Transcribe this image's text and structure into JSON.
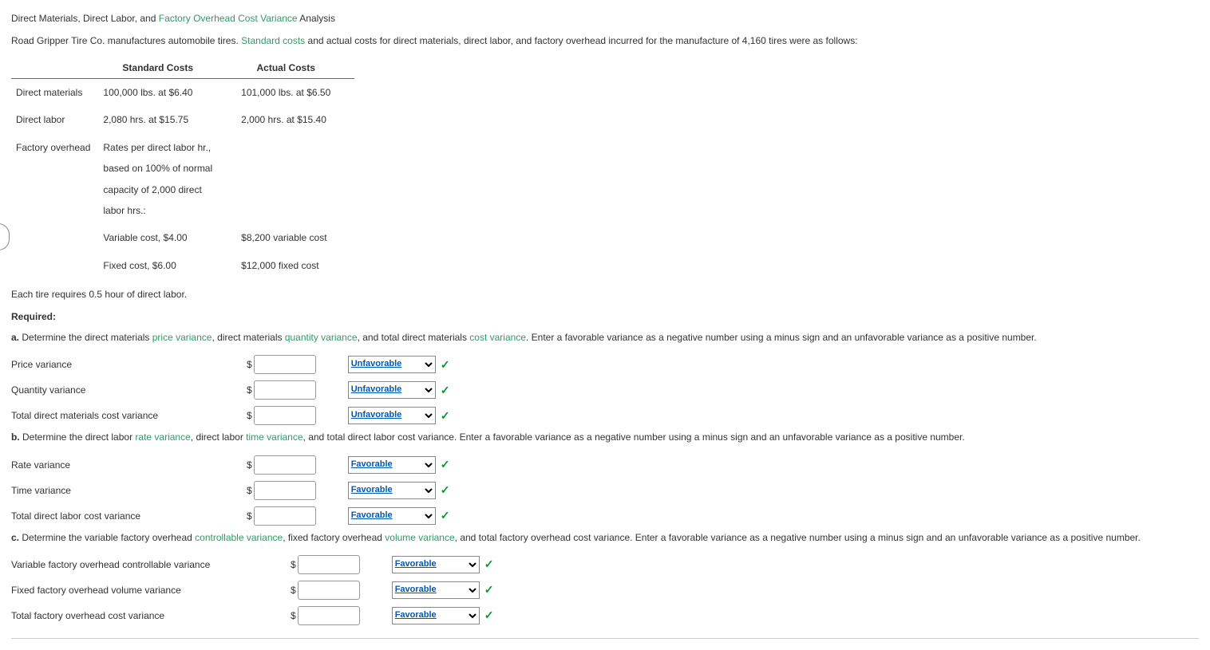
{
  "title": {
    "pre": "Direct Materials, Direct Labor, and ",
    "link": "Factory Overhead Cost Variance",
    "post": " Analysis"
  },
  "intro": {
    "pre": "Road Gripper Tire Co. manufactures automobile tires. ",
    "link": "Standard costs",
    "post": " and actual costs for direct materials, direct labor, and factory overhead incurred for the manufacture of 4,160 tires were as follows:"
  },
  "cost_table": {
    "headers": {
      "c1": "",
      "c2": "Standard Costs",
      "c3": "Actual Costs"
    },
    "rows": [
      {
        "label": "Direct materials",
        "std": "100,000 lbs. at $6.40",
        "act": "101,000 lbs. at $6.50"
      },
      {
        "label": "Direct labor",
        "std": "2,080 hrs. at $15.75",
        "act": "2,000 hrs. at $15.40"
      },
      {
        "label": "Factory overhead",
        "std": "Rates per direct labor hr.,\nbased on 100% of normal\ncapacity of 2,000 direct\nlabor hrs.:",
        "act": ""
      },
      {
        "label": "",
        "std": "   Variable cost, $4.00",
        "act": "$8,200 variable cost"
      },
      {
        "label": "",
        "std": "   Fixed cost, $6.00",
        "act": "$12,000 fixed cost"
      }
    ]
  },
  "note": "Each tire requires 0.5 hour of direct labor.",
  "required_heading": "Required:",
  "questions": {
    "a": {
      "letter": "a.",
      "text1": "  Determine the direct materials ",
      "link1": "price variance",
      "text2": ", direct materials ",
      "link2": "quantity variance",
      "text3": ", and total direct materials ",
      "link3": "cost variance",
      "text4": ". Enter a favorable variance as a negative number using a minus sign and an unfavorable variance as a positive number.",
      "rows": [
        {
          "label": "Price variance",
          "dd": "Unfavorable"
        },
        {
          "label": "Quantity variance",
          "dd": "Unfavorable"
        },
        {
          "label": "Total direct materials cost variance",
          "dd": "Unfavorable"
        }
      ]
    },
    "b": {
      "letter": "b.",
      "text1": "  Determine the direct labor ",
      "link1": "rate variance",
      "text2": ", direct labor ",
      "link2": "time variance",
      "text3": ", and total direct labor cost variance. Enter a favorable variance as a negative number using a minus sign and an unfavorable variance as a positive number.",
      "rows": [
        {
          "label": "Rate variance",
          "dd": "Favorable"
        },
        {
          "label": "Time variance",
          "dd": "Favorable"
        },
        {
          "label": "Total direct labor cost variance",
          "dd": "Favorable"
        }
      ]
    },
    "c": {
      "letter": "c.",
      "text1": "  Determine the variable factory overhead ",
      "link1": "controllable variance",
      "text2": ", fixed factory overhead ",
      "link2": "volume variance",
      "text3": ", and total factory overhead cost variance. Enter a favorable variance as a negative number using a minus sign and an unfavorable variance as a positive number.",
      "rows": [
        {
          "label": "Variable factory overhead controllable variance",
          "dd": "Favorable"
        },
        {
          "label": "Fixed factory overhead volume variance",
          "dd": "Favorable"
        },
        {
          "label": "Total factory overhead cost variance",
          "dd": "Favorable"
        }
      ]
    }
  },
  "currency_sign": "$",
  "checkmark": "✓"
}
